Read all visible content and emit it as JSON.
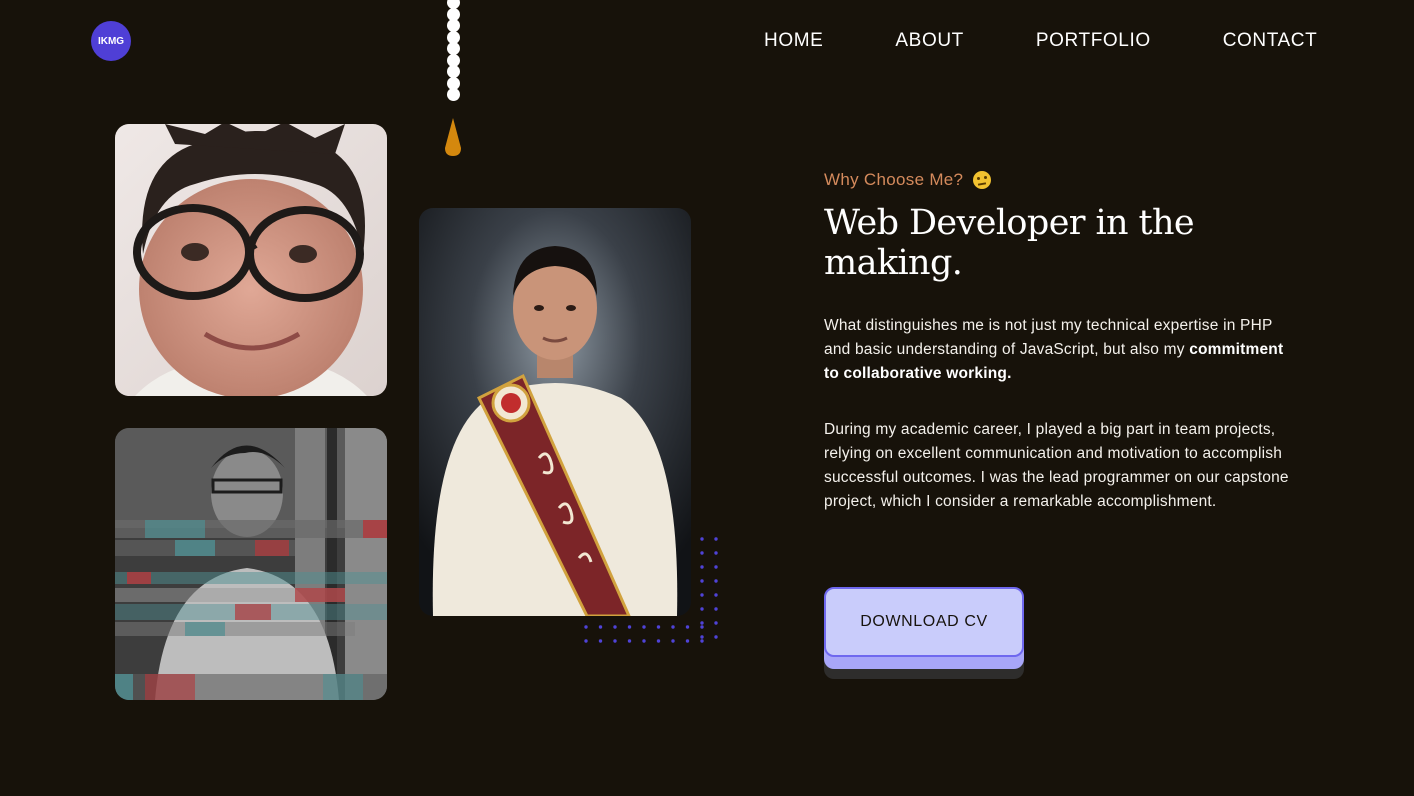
{
  "header": {
    "logo_text": "IKMG",
    "nav": [
      {
        "label": "HOME"
      },
      {
        "label": "ABOUT"
      },
      {
        "label": "PORTFOLIO"
      },
      {
        "label": "CONTACT"
      }
    ]
  },
  "hero": {
    "eyebrow": "Why Choose Me?",
    "eyebrow_icon": "thinking-face-emoji",
    "title": "Web Developer in the making.",
    "paragraph1": {
      "text": "What distinguishes me is not just my technical expertise in PHP and basic understanding of JavaScript, but also my ",
      "emphasis": "commitment to collaborative working."
    },
    "paragraph2": "During my academic career, I played a big part in team projects, relying on excellent communication and motivation to accomplish successful outcomes. I was the lead programmer on our capstone project, which I consider a remarkable accomplishment.",
    "button_label": "DOWNLOAD CV"
  },
  "colors": {
    "background": "#17120a",
    "logo": "#4f3fd6",
    "eyebrow": "#d48a5c",
    "button": "#c9ccfb",
    "button_border": "#6f68ef",
    "dots": "#4f43d8",
    "pendulum": "#d4880e"
  }
}
